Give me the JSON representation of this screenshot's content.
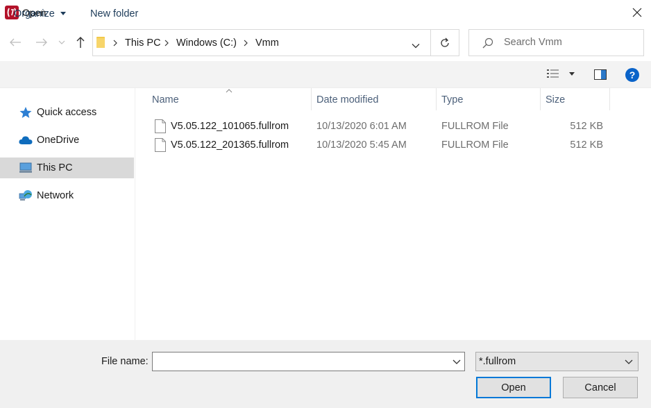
{
  "window": {
    "title": "Open"
  },
  "nav": {
    "breadcrumb": [
      "This PC",
      "Windows (C:)",
      "Vmm"
    ],
    "search_placeholder": "Search Vmm"
  },
  "toolbar": {
    "organize_label": "Organize",
    "new_folder_label": "New folder"
  },
  "sidebar": {
    "items": [
      {
        "label": "Quick access",
        "icon": "star-icon"
      },
      {
        "label": "OneDrive",
        "icon": "cloud-icon"
      },
      {
        "label": "This PC",
        "icon": "computer-icon",
        "selected": true
      },
      {
        "label": "Network",
        "icon": "network-icon"
      }
    ]
  },
  "file_list": {
    "columns": [
      "Name",
      "Date modified",
      "Type",
      "Size"
    ],
    "sorted_column": "Name",
    "rows": [
      {
        "name": "V5.05.122_101065.fullrom",
        "date": "10/13/2020 6:01 AM",
        "type": "FULLROM File",
        "size": "512 KB"
      },
      {
        "name": "V5.05.122_201365.fullrom",
        "date": "10/13/2020 5:45 AM",
        "type": "FULLROM File",
        "size": "512 KB"
      }
    ]
  },
  "footer": {
    "file_name_label": "File name:",
    "file_name_value": "",
    "filter_value": "*.fullrom",
    "open_label": "Open",
    "cancel_label": "Cancel"
  },
  "colors": {
    "accent": "#0078d7",
    "help_icon": "#0a63c9",
    "selected_bg": "#d9d9d9",
    "command_bar_bg": "#f3f3f3",
    "footer_bg": "#f0f0f0"
  }
}
